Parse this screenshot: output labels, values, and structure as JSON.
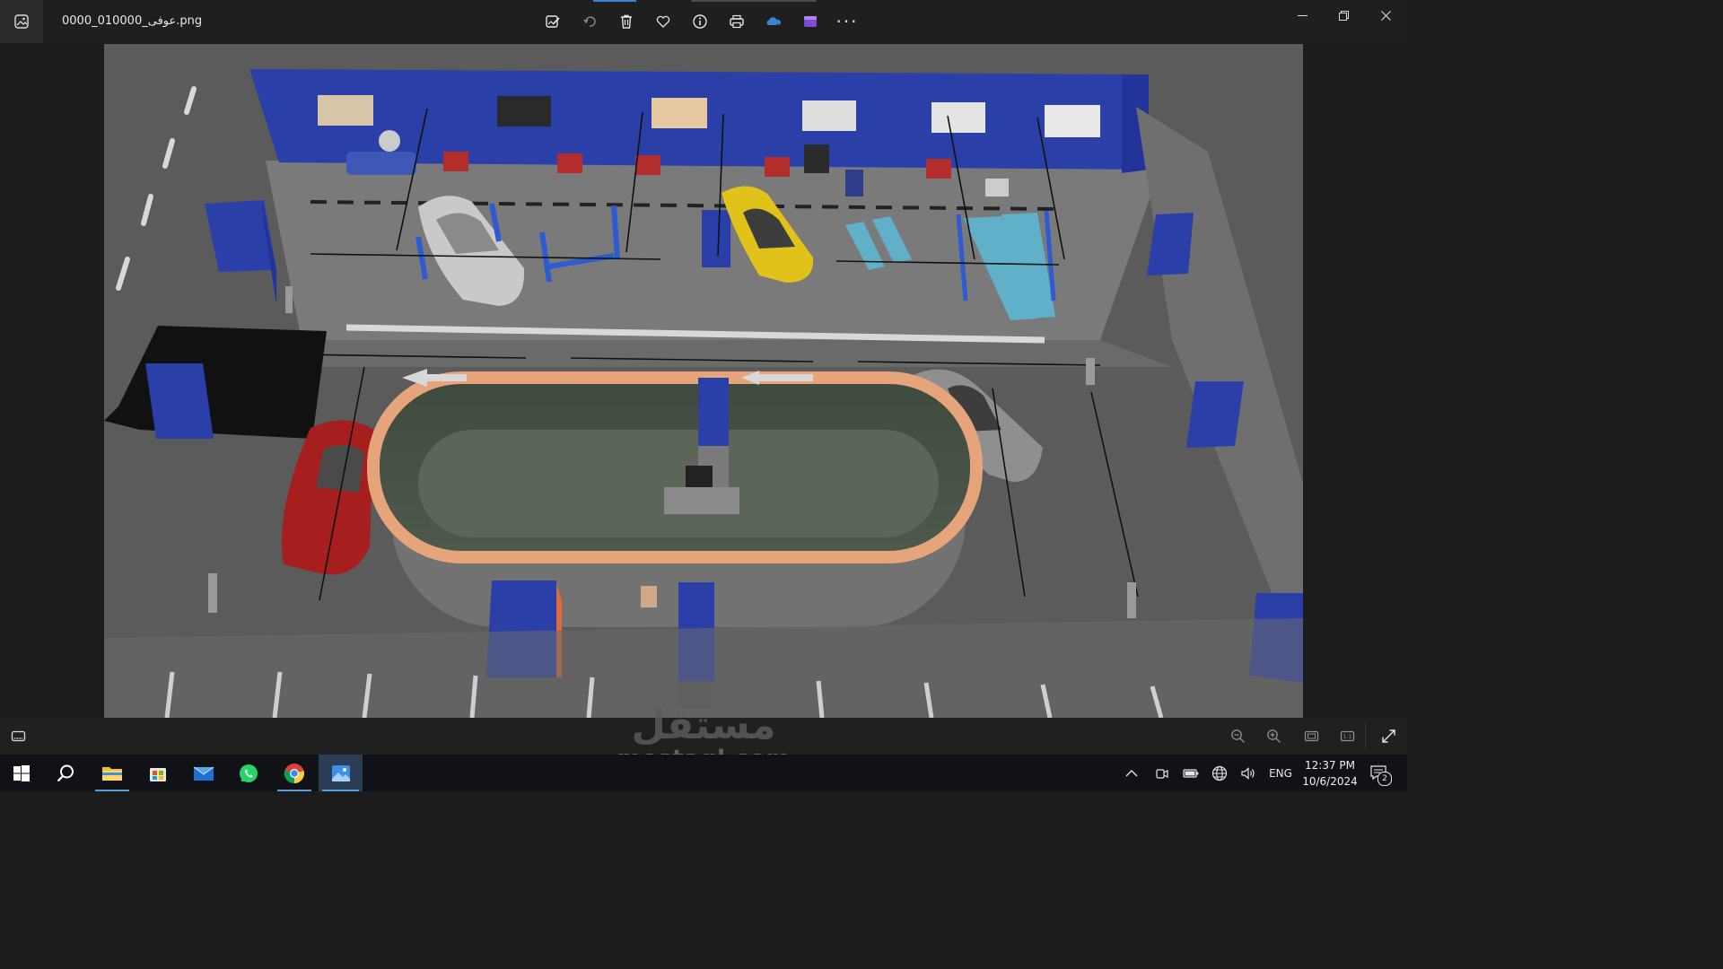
{
  "window": {
    "title": "عوفى_010000_0000.png",
    "controls": [
      "minimize-icon",
      "restore-icon",
      "close-icon"
    ]
  },
  "toolbar": {
    "items": [
      {
        "name": "edit-image-icon"
      },
      {
        "name": "rotate-icon"
      },
      {
        "name": "delete-icon"
      },
      {
        "name": "favorite-icon"
      },
      {
        "name": "info-icon"
      },
      {
        "name": "print-icon"
      },
      {
        "name": "onedrive-icon",
        "color": "#3a83d6"
      },
      {
        "name": "clipchamp-icon",
        "color": "#7b4cd8"
      },
      {
        "name": "more-options-icon"
      }
    ]
  },
  "scene": {
    "description_icon": "car-service-garage-render",
    "accent_blue": "#2b3fa8",
    "ring_color": "#e6a47a"
  },
  "bottombar": {
    "icons": [
      "filmstrip-icon",
      "zoom-out-icon",
      "zoom-in-icon",
      "fit-to-window-icon",
      "actual-size-icon",
      "fullscreen-icon"
    ]
  },
  "watermark": {
    "arabic": "مستقل",
    "latin": "mostaql.com"
  },
  "taskbar": {
    "apps": [
      "start-icon",
      "search-icon",
      "file-explorer-icon",
      "microsoft-store-icon",
      "mail-icon",
      "whatsapp-icon",
      "chrome-icon",
      "photos-icon"
    ],
    "tray": {
      "language": "ENG",
      "time": "12:37 PM",
      "date": "10/6/2024",
      "notifications": "2"
    }
  }
}
